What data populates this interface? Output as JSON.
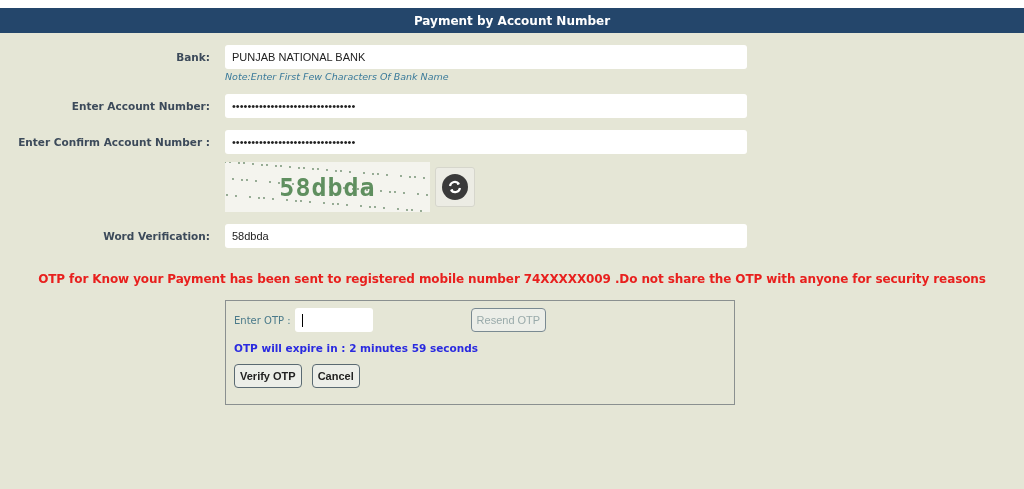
{
  "header": {
    "title": "Payment by Account Number"
  },
  "form": {
    "bank": {
      "label": "Bank:",
      "value": "PUNJAB NATIONAL BANK",
      "note": "Note:Enter First Few Characters Of Bank Name"
    },
    "account": {
      "label": "Enter Account Number:",
      "value": "••••••••••••••••••••••••••••••••"
    },
    "confirm_account": {
      "label": "Enter Confirm Account Number :",
      "value": "••••••••••••••••••••••••••••••••"
    },
    "captcha": {
      "text": "58dbda"
    },
    "word_verification": {
      "label": "Word Verification:",
      "value": "58dbda"
    }
  },
  "otp_message": "OTP for Know your Payment has been sent to registered mobile number 74XXXXX009 .Do not share the OTP with anyone for security reasons",
  "otp_panel": {
    "label": "Enter OTP :",
    "resend": {
      "label": "Resend OTP",
      "disabled": true
    },
    "expiry": "OTP will expire in : 2 minutes 59 seconds",
    "buttons": [
      {
        "label": "Verify OTP"
      },
      {
        "label": "Cancel"
      }
    ]
  }
}
